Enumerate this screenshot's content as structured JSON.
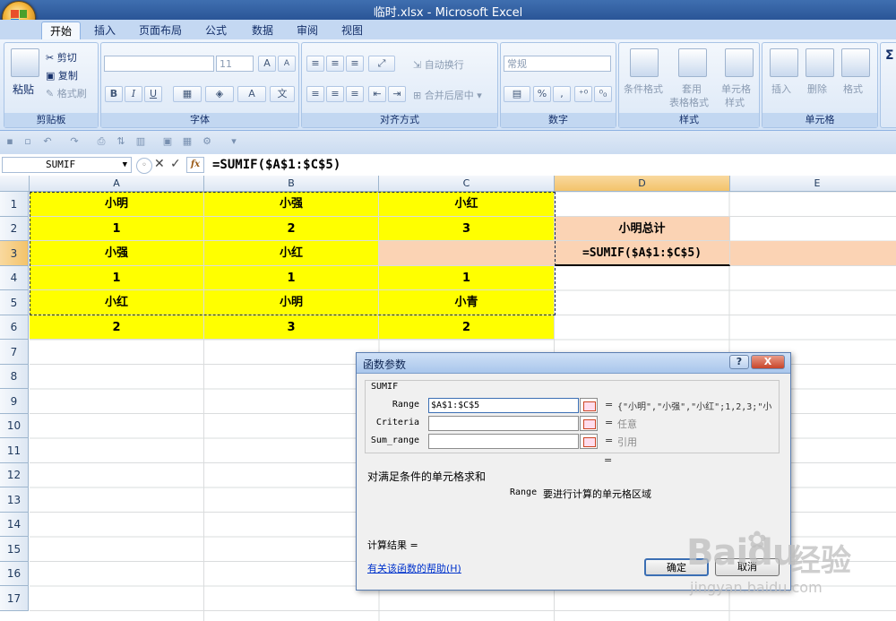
{
  "window": {
    "title": "临时.xlsx - Microsoft Excel"
  },
  "tabs": [
    "开始",
    "插入",
    "页面布局",
    "公式",
    "数据",
    "审阅",
    "视图"
  ],
  "ribbon": {
    "clipboard": {
      "paste": "粘贴",
      "cut": "剪切",
      "copy": "复制",
      "format_painter": "格式刷",
      "label": "剪贴板"
    },
    "font": {
      "size": "11",
      "bold": "B",
      "italic": "I",
      "underline": "U",
      "label": "字体",
      "grow": "A",
      "shrink": "A"
    },
    "alignment": {
      "wrap": "自动换行",
      "merge": "合并后居中",
      "label": "对齐方式"
    },
    "number": {
      "format": "常规",
      "percent": "%",
      "comma": ",",
      "label": "数字"
    },
    "styles": {
      "conditional": "条件格式",
      "table_format_1": "套用",
      "table_format_2": "表格格式",
      "cell_styles_1": "单元格",
      "cell_styles_2": "样式",
      "label": "样式"
    },
    "cells": {
      "insert": "插入",
      "delete": "删除",
      "format": "格式",
      "label": "单元格"
    },
    "editing": {
      "sigma": "Σ"
    }
  },
  "formula_bar": {
    "name_box": "SUMIF",
    "formula": "=SUMIF($A$1:$C$5)",
    "fx": "fx"
  },
  "columns": [
    "A",
    "B",
    "C",
    "D",
    "E"
  ],
  "rows": [
    "1",
    "2",
    "3",
    "4",
    "5",
    "6",
    "7",
    "8",
    "9",
    "10",
    "11",
    "12",
    "13",
    "14",
    "15",
    "16",
    "17"
  ],
  "cells": {
    "A1": "小明",
    "B1": "小强",
    "C1": "小红",
    "A2": "1",
    "B2": "2",
    "C2": "3",
    "D2": "小明总计",
    "A3": "小强",
    "B3": "小红",
    "D3": "=SUMIF($A$1:$C$5)",
    "A4": "1",
    "B4": "1",
    "C4": "1",
    "A5": "小红",
    "B5": "小明",
    "C5": "小青",
    "A6": "2",
    "B6": "3",
    "C6": "2"
  },
  "colors": {
    "highlight_yellow": "#ffff00",
    "peach": "#fbd3b4",
    "ribbon_blue": "#d4e3f6"
  },
  "dialog": {
    "title": "函数参数",
    "help": "?",
    "close": "X",
    "function_name": "SUMIF",
    "args": [
      {
        "label": "Range",
        "value": "$A$1:$C$5",
        "eq": "=",
        "result": "{\"小明\",\"小强\",\"小红\";1,2,3;\"小"
      },
      {
        "label": "Criteria",
        "value": "",
        "eq": "=",
        "result": "任意"
      },
      {
        "label": "Sum_range",
        "value": "",
        "eq": "=",
        "result": "引用"
      }
    ],
    "result_eq": "=",
    "description": "对满足条件的单元格求和",
    "arg_help_name": "Range",
    "arg_help_text": "要进行计算的单元格区域",
    "calc_result": "计算结果 =",
    "help_link": "有关该函数的帮助(H)",
    "ok": "确定",
    "cancel": "取消"
  },
  "watermark": {
    "brand": "Baidu",
    "brand_cn": "经验",
    "url": "jingyan.baidu.com"
  }
}
